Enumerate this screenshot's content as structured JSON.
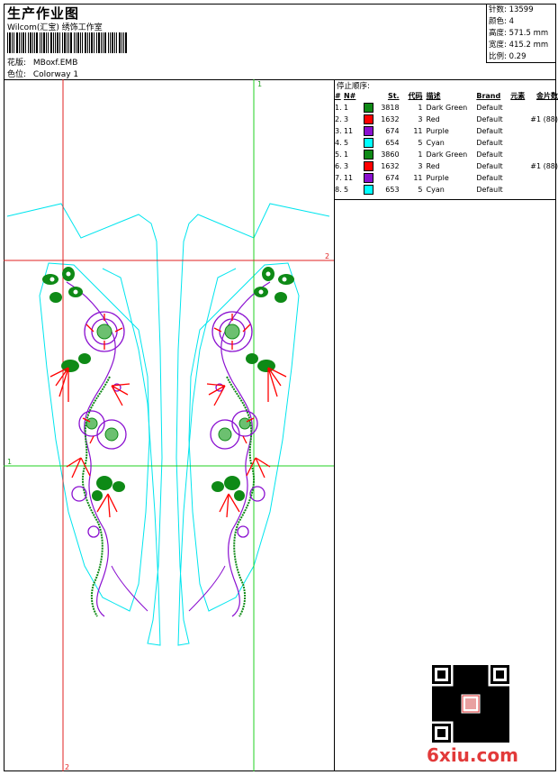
{
  "header": {
    "title": "生产作业图",
    "subtitle": "Wilcom(汇宝) 绣饰工作室",
    "design_label": "花版:",
    "design_value": "MBoxf.EMB",
    "colorway_label": "色位:",
    "colorway_value": "Colorway 1"
  },
  "stats": {
    "stitches": "针数: 13599",
    "colors": "颜色: 4",
    "height": "高度: 571.5 mm",
    "width": "宽度: 415.2 mm",
    "scale": "比例: 0.29"
  },
  "sequence": {
    "title": "停止顺序:",
    "headers": [
      "#",
      "N#",
      "St.",
      "代码",
      "描述",
      "Brand",
      "元素",
      "金片数"
    ],
    "rows": [
      {
        "idx": "1.",
        "n": "1",
        "color": "#0e8a16",
        "st": "3818",
        "code": "1",
        "desc": "Dark Green",
        "brand": "Default",
        "elem": "",
        "seq": ""
      },
      {
        "idx": "2.",
        "n": "3",
        "color": "#ff0000",
        "st": "1632",
        "code": "3",
        "desc": "Red",
        "brand": "Default",
        "elem": "",
        "seq": "#1 (88)"
      },
      {
        "idx": "3.",
        "n": "11",
        "color": "#8a0fd0",
        "st": "674",
        "code": "11",
        "desc": "Purple",
        "brand": "Default",
        "elem": "",
        "seq": ""
      },
      {
        "idx": "4.",
        "n": "5",
        "color": "#00ffff",
        "st": "654",
        "code": "5",
        "desc": "Cyan",
        "brand": "Default",
        "elem": "",
        "seq": ""
      },
      {
        "idx": "5.",
        "n": "1",
        "color": "#0e8a16",
        "st": "3860",
        "code": "1",
        "desc": "Dark Green",
        "brand": "Default",
        "elem": "",
        "seq": ""
      },
      {
        "idx": "6.",
        "n": "3",
        "color": "#ff0000",
        "st": "1632",
        "code": "3",
        "desc": "Red",
        "brand": "Default",
        "elem": "",
        "seq": "#1 (88)"
      },
      {
        "idx": "7.",
        "n": "11",
        "color": "#8a0fd0",
        "st": "674",
        "code": "11",
        "desc": "Purple",
        "brand": "Default",
        "elem": "",
        "seq": ""
      },
      {
        "idx": "8.",
        "n": "5",
        "color": "#00ffff",
        "st": "653",
        "code": "5",
        "desc": "Cyan",
        "brand": "Default",
        "elem": "",
        "seq": ""
      }
    ]
  },
  "guides": {
    "v1_label": "1",
    "h2_label": "2",
    "h1_label": "1",
    "v2_label": "2"
  },
  "watermark": "6xiu.com",
  "colors": {
    "outline": "#00e5ee",
    "guide_red": "#e02020",
    "guide_green": "#20d020"
  }
}
